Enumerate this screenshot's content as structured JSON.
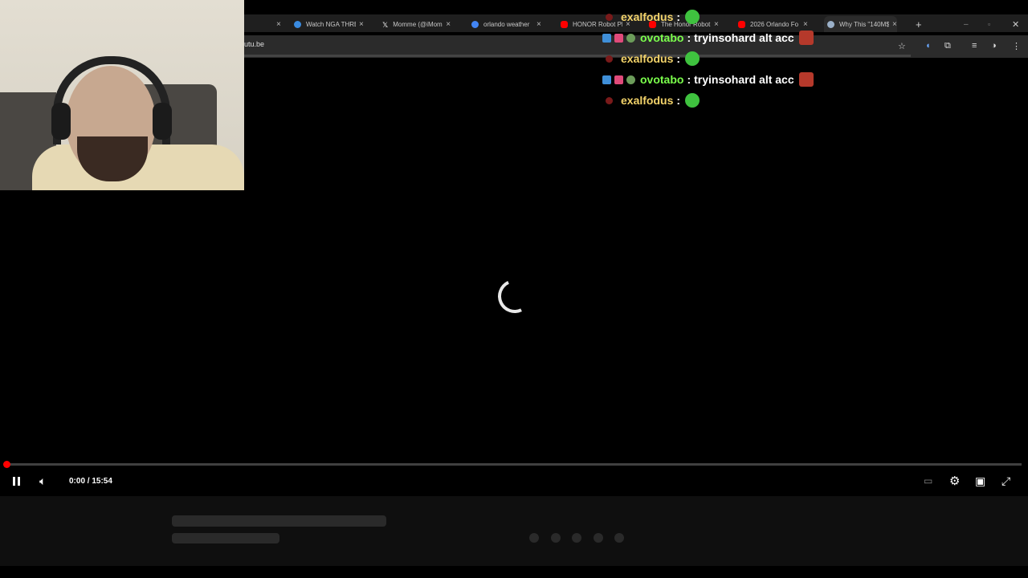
{
  "browser": {
    "tabs": [
      {
        "label": "",
        "favicon_color": "#888888"
      },
      {
        "label": "Watch NGA THRE",
        "favicon_color": "#3a8be0"
      },
      {
        "label": "Momme (@iMom",
        "favicon_color": "#ffffff"
      },
      {
        "label": "orlando weather",
        "favicon_color": "#4285f4"
      },
      {
        "label": "HONOR Robot Pl",
        "favicon_color": "#ff0000"
      },
      {
        "label": "The Honor Robot",
        "favicon_color": "#ff0000"
      },
      {
        "label": "2026 Orlando Fo",
        "favicon_color": "#ff0000"
      },
      {
        "label": "Why This \"140M$",
        "favicon_color": "#9ab0c8"
      }
    ],
    "close_glyph": "×",
    "new_tab_glyph": "+",
    "url": "utu.be"
  },
  "chat": {
    "messages": [
      {
        "user": "exalfodus",
        "user_color": "#f3d36a",
        "separator": ":",
        "text": "",
        "emote": "green"
      },
      {
        "user": "ovotabo",
        "user_color": "#7bff4c",
        "separator": ":",
        "text": "tryinsohard alt acc",
        "emote": "red"
      },
      {
        "user": "exalfodus",
        "user_color": "#f3d36a",
        "separator": ":",
        "text": "",
        "emote": "green"
      },
      {
        "user": "ovotabo",
        "user_color": "#7bff4c",
        "separator": ":",
        "text": "tryinsohard alt acc",
        "emote": "red"
      },
      {
        "user": "exalfodus",
        "user_color": "#f3d36a",
        "separator": ":",
        "text": "",
        "emote": "green"
      }
    ]
  },
  "player": {
    "time_display": "0:00 / 15:54",
    "progress_fraction": 0.0,
    "state": "playing",
    "loading": true
  },
  "colors": {
    "accent": "#ff0000",
    "background": "#000000"
  }
}
